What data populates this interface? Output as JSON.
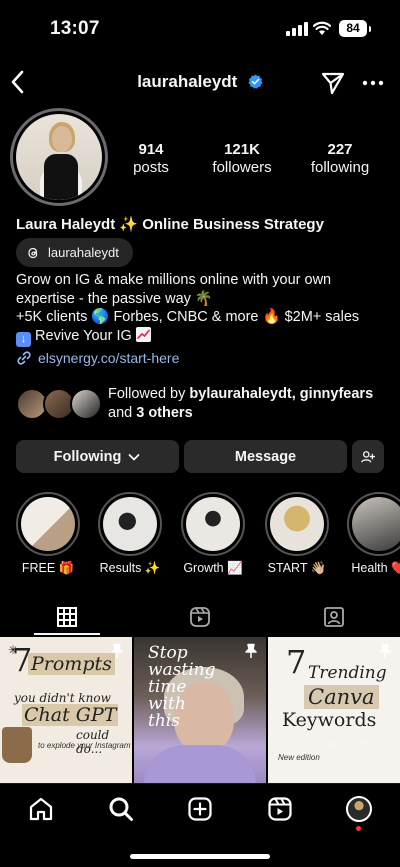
{
  "status_bar": {
    "time": "13:07",
    "battery": "84"
  },
  "header": {
    "username": "laurahaleydt"
  },
  "profile": {
    "stats": [
      {
        "value": "914",
        "label": "posts"
      },
      {
        "value": "121K",
        "label": "followers"
      },
      {
        "value": "227",
        "label": "following"
      }
    ],
    "full_name": "Laura Haleydt ✨ Online Business Strategy",
    "threads_handle": "laurahaleydt",
    "bio_lines": [
      "Grow on IG & make millions online with your own",
      "expertise - the passive way 🌴",
      "+5K clients 🌎 Forbes, CNBC & more 🔥 $2M+ sales",
      "Revive Your IG"
    ],
    "link": "elsynergy.co/start-here"
  },
  "followed_by": {
    "prefix": "Followed by ",
    "names": "bylaurahaleydt, ginnyfears",
    "and": "and ",
    "others": "3 others"
  },
  "actions": {
    "following": "Following",
    "message": "Message"
  },
  "highlights": [
    {
      "label": "FREE 🎁"
    },
    {
      "label": "Results ✨"
    },
    {
      "label": "Growth 📈"
    },
    {
      "label": "START 👋🏼"
    },
    {
      "label": "Health ❤️"
    }
  ],
  "posts": [
    {
      "lines": [
        "7",
        "Prompts",
        "you didn't know",
        "Chat GPT",
        "could do...",
        "to explode your Instagram"
      ]
    },
    {
      "lines": [
        "Stop",
        "wasting",
        "time",
        "with",
        "this"
      ]
    },
    {
      "lines": [
        "7",
        "Trending",
        "Canva",
        "Keywords",
        "New edition"
      ]
    }
  ],
  "icons": {
    "back": "chevron-left-icon",
    "verified": "verified-badge-icon",
    "send": "paper-plane-icon",
    "more": "ellipsis-icon",
    "grid": "grid-icon",
    "reels": "reels-icon",
    "tagged": "tagged-icon",
    "home": "home-icon",
    "search": "search-icon",
    "create": "plus-square-icon"
  },
  "colors": {
    "link": "#9ab8ee",
    "verified": "#3797f0",
    "notification_dot": "#ff3040"
  }
}
